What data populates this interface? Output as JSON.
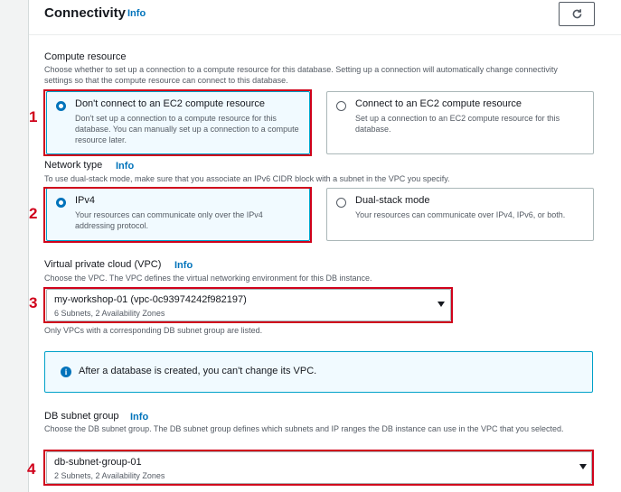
{
  "header": {
    "title": "Connectivity",
    "info_label": "Info",
    "refresh_icon": "refresh-icon"
  },
  "compute": {
    "label": "Compute resource",
    "description": "Choose whether to set up a connection to a compute resource for this database. Setting up a connection will automatically change connectivity settings so that the compute resource can connect to this database.",
    "options": [
      {
        "title": "Don't connect to an EC2 compute resource",
        "description": "Don't set up a connection to a compute resource for this database. You can manually set up a connection to a compute resource later.",
        "selected": true
      },
      {
        "title": "Connect to an EC2 compute resource",
        "description": "Set up a connection to an EC2 compute resource for this database.",
        "selected": false
      }
    ]
  },
  "network": {
    "label": "Network type",
    "info_label": "Info",
    "description": "To use dual-stack mode, make sure that you associate an IPv6 CIDR block with a subnet in the VPC you specify.",
    "options": [
      {
        "title": "IPv4",
        "description": "Your resources can communicate only over the IPv4 addressing protocol.",
        "selected": true
      },
      {
        "title": "Dual-stack mode",
        "description": "Your resources can communicate over IPv4, IPv6, or both.",
        "selected": false
      }
    ]
  },
  "vpc": {
    "label": "Virtual private cloud (VPC)",
    "info_label": "Info",
    "description": "Choose the VPC. The VPC defines the virtual networking environment for this DB instance.",
    "value": "my-workshop-01 (vpc-0c93974242f982197)",
    "subtext": "6 Subnets, 2 Availability Zones",
    "hint": "Only VPCs with a corresponding DB subnet group are listed."
  },
  "alert": {
    "text": "After a database is created, you can't change its VPC."
  },
  "subnet": {
    "label": "DB subnet group",
    "info_label": "Info",
    "description": "Choose the DB subnet group. The DB subnet group defines which subnets and IP ranges the DB instance can use in the VPC that you selected.",
    "value": "db-subnet-group-01",
    "subtext": "2 Subnets, 2 Availability Zones"
  },
  "annotations": [
    "1",
    "2",
    "3",
    "4"
  ],
  "colors": {
    "highlight": "#d0021b",
    "accent": "#0073bb",
    "selected_border": "#00a1c9"
  }
}
